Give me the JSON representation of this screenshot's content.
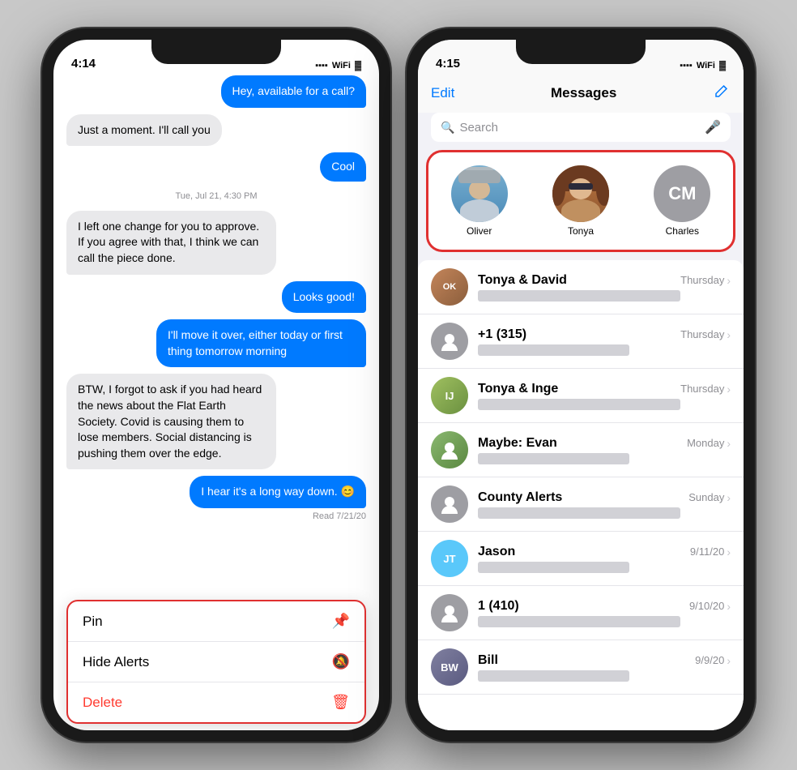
{
  "left_phone": {
    "status_time": "4:14",
    "chat": {
      "messages": [
        {
          "id": 1,
          "type": "outgoing",
          "text": "Hey, available for a call?"
        },
        {
          "id": 2,
          "type": "incoming",
          "text": "Just a moment. I'll call you"
        },
        {
          "id": 3,
          "type": "outgoing",
          "text": "Cool"
        },
        {
          "id": 4,
          "type": "timestamp",
          "text": "Tue, Jul 21, 4:30 PM"
        },
        {
          "id": 5,
          "type": "incoming",
          "text": "I left one change for you to approve. If you agree with that, I think we can call the piece done."
        },
        {
          "id": 6,
          "type": "outgoing",
          "text": "Looks good!"
        },
        {
          "id": 7,
          "type": "outgoing",
          "text": "I'll move it over, either today or first thing tomorrow morning"
        },
        {
          "id": 8,
          "type": "incoming",
          "text": "BTW, I forgot to ask if you had heard the news about the Flat Earth Society.  Covid is causing them to lose members. Social distancing is pushing them over the edge."
        },
        {
          "id": 9,
          "type": "outgoing",
          "text": "I hear it's a long way down. 😊"
        },
        {
          "id": 10,
          "type": "read",
          "text": "Read 7/21/20"
        }
      ]
    },
    "context_menu": {
      "items": [
        {
          "id": "pin",
          "label": "Pin",
          "icon": "📌",
          "color": "normal"
        },
        {
          "id": "hide_alerts",
          "label": "Hide Alerts",
          "icon": "🔕",
          "color": "normal"
        },
        {
          "id": "delete",
          "label": "Delete",
          "icon": "🗑",
          "color": "red"
        }
      ]
    }
  },
  "right_phone": {
    "status_time": "4:15",
    "nav": {
      "edit_label": "Edit",
      "title": "Messages",
      "compose_icon": "✏"
    },
    "search": {
      "placeholder": "Search",
      "mic_icon": "🎤"
    },
    "pinned_contacts": [
      {
        "name": "Oliver",
        "initials": "",
        "avatar_type": "oliver"
      },
      {
        "name": "Tonya",
        "initials": "",
        "avatar_type": "tonya"
      },
      {
        "name": "Charles",
        "initials": "CM",
        "avatar_type": "initials"
      }
    ],
    "conversations": [
      {
        "id": 1,
        "name": "Tonya & David",
        "time": "Thursday",
        "avatar_type": "tonya-david",
        "initials": "",
        "bold": true
      },
      {
        "id": 2,
        "name": "+1 (315)",
        "time": "Thursday",
        "avatar_type": "generic",
        "initials": "",
        "bold": false
      },
      {
        "id": 3,
        "name": "Tonya & Inge",
        "time": "Thursday",
        "avatar_type": "tonya-inge",
        "initials": "IJ",
        "bold": false
      },
      {
        "id": 4,
        "name": "Maybe: Evan",
        "time": "Monday",
        "avatar_type": "evan",
        "initials": "",
        "bold": false
      },
      {
        "id": 5,
        "name": "County Alerts",
        "time": "Sunday",
        "avatar_type": "county",
        "initials": "",
        "bold": true
      },
      {
        "id": 6,
        "name": "Jason",
        "time": "9/11/20",
        "avatar_type": "jt",
        "initials": "JT",
        "bold": false
      },
      {
        "id": 7,
        "name": "1 (410)",
        "time": "9/10/20",
        "avatar_type": "generic",
        "initials": "",
        "bold": false
      },
      {
        "id": 8,
        "name": "Bill",
        "time": "9/9/20",
        "avatar_type": "bw",
        "initials": "BW",
        "bold": false
      }
    ]
  }
}
